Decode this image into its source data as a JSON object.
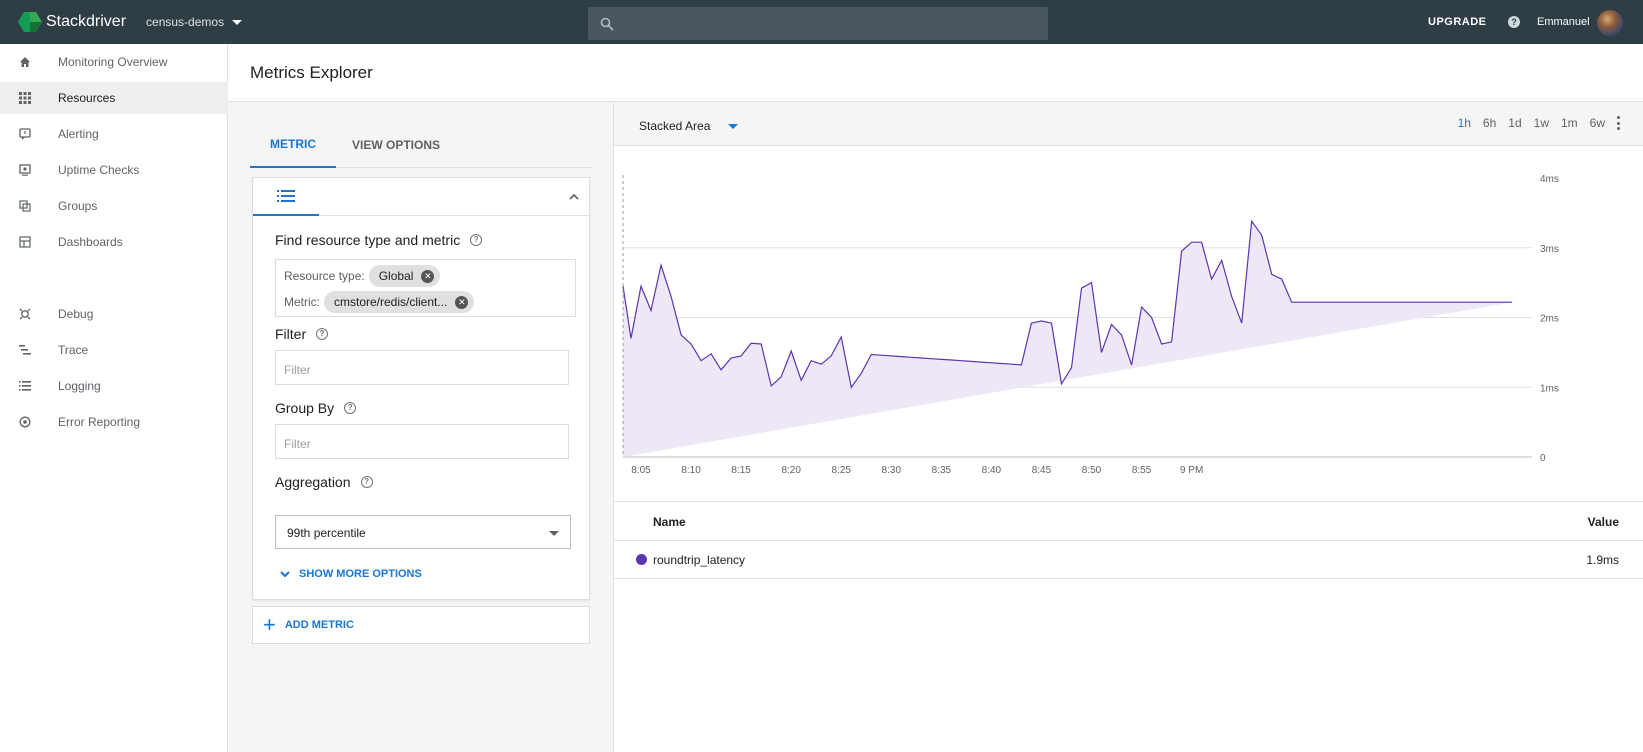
{
  "app": {
    "name": "Stackdriver",
    "project": "census-demos",
    "upgrade_label": "UPGRADE",
    "user": "Emmanuel",
    "help_icon": "help-icon"
  },
  "sidebar": {
    "items": [
      {
        "label": "Monitoring Overview",
        "icon": "home-icon"
      },
      {
        "label": "Resources",
        "icon": "grid-icon",
        "active": true
      },
      {
        "label": "Alerting",
        "icon": "alert-icon"
      },
      {
        "label": "Uptime Checks",
        "icon": "uptime-icon"
      },
      {
        "label": "Groups",
        "icon": "groups-icon"
      },
      {
        "label": "Dashboards",
        "icon": "dashboards-icon"
      },
      {
        "label": "Debug",
        "icon": "debug-icon"
      },
      {
        "label": "Trace",
        "icon": "trace-icon"
      },
      {
        "label": "Logging",
        "icon": "logging-icon"
      },
      {
        "label": "Error Reporting",
        "icon": "error-reporting-icon"
      }
    ]
  },
  "page": {
    "title": "Metrics Explorer"
  },
  "metric_panel": {
    "tabs": [
      "METRIC",
      "VIEW OPTIONS"
    ],
    "find_label": "Find resource type and metric",
    "resource_type_label": "Resource type:",
    "resource_type_value": "Global",
    "metric_label": "Metric:",
    "metric_value": "cmstore/redis/client...",
    "filter_label": "Filter",
    "filter_placeholder": "Filter",
    "group_by_label": "Group By",
    "group_by_placeholder": "Filter",
    "aggregation_label": "Aggregation",
    "aggregation_value": "99th percentile",
    "show_more_label": "SHOW MORE OPTIONS",
    "add_metric_label": "ADD METRIC"
  },
  "chart_toolbar": {
    "chart_type": "Stacked Area",
    "ranges": [
      "1h",
      "6h",
      "1d",
      "1w",
      "1m",
      "6w"
    ],
    "active_range": "1h"
  },
  "legend_table": {
    "name_header": "Name",
    "value_header": "Value",
    "rows": [
      {
        "name": "roundtrip_latency",
        "value": "1.9ms",
        "color": "#5e35b1"
      }
    ]
  },
  "chart_data": {
    "type": "area",
    "stacked": true,
    "x_ticks": [
      "8:05",
      "8:10",
      "8:15",
      "8:20",
      "8:25",
      "8:30",
      "8:35",
      "8:40",
      "8:45",
      "8:50",
      "8:55",
      "9 PM"
    ],
    "y_ticks": [
      "4ms",
      "3ms",
      "2ms",
      "1ms",
      "0"
    ],
    "ylim": [
      0,
      4
    ],
    "y_unit": "ms",
    "grid": true,
    "series": [
      {
        "name": "roundtrip_latency",
        "color": "#5e35b1",
        "fill": "#ede7f6",
        "x_minutes_from_805": [
          -1.8,
          -1,
          0,
          1,
          2,
          3,
          4,
          5,
          6,
          7,
          8,
          9,
          10,
          11,
          12,
          13,
          14,
          15,
          16,
          17,
          18,
          19,
          20,
          21,
          22,
          23,
          24,
          25,
          26,
          27,
          28,
          29,
          30,
          31,
          32,
          33,
          34,
          35,
          36,
          37,
          38,
          39,
          40,
          41,
          42,
          43,
          44,
          45,
          46,
          47,
          48,
          49,
          50,
          51,
          52,
          53,
          54,
          55,
          56,
          57,
          58,
          59,
          60,
          61,
          62,
          63,
          64,
          65,
          66,
          67,
          68,
          69,
          70,
          71,
          72,
          73,
          74,
          75,
          76,
          77,
          78,
          79,
          80,
          81,
          82,
          83,
          84,
          85,
          86,
          87,
          88,
          89
        ],
        "values": [
          2.45,
          1.7,
          2.45,
          2.1,
          2.75,
          2.3,
          1.75,
          1.62,
          1.38,
          1.48,
          1.25,
          1.42,
          1.45,
          1.63,
          1.62,
          1.02,
          1.15,
          1.52,
          1.1,
          1.38,
          1.33,
          1.45,
          1.72,
          1.0,
          1.2,
          1.47,
          1.46,
          1.45,
          1.44,
          1.43,
          1.42,
          1.41,
          1.4,
          1.39,
          1.38,
          1.37,
          1.36,
          1.35,
          1.34,
          1.33,
          1.32,
          1.92,
          1.95,
          1.92,
          1.05,
          1.28,
          2.42,
          2.5,
          1.5,
          1.9,
          1.75,
          1.32,
          2.15,
          2.0,
          1.62,
          1.65,
          2.95,
          3.08,
          3.08,
          2.55,
          2.82,
          2.3,
          1.92,
          3.38,
          3.18,
          2.62,
          2.55,
          2.22,
          2.22,
          2.22,
          2.22,
          2.22,
          2.22,
          2.22,
          2.22,
          2.22,
          2.22,
          2.22,
          2.22,
          2.22,
          2.22,
          2.22,
          2.22,
          2.22,
          2.22,
          2.22,
          2.22,
          2.22,
          2.22,
          2.22
        ]
      }
    ]
  }
}
